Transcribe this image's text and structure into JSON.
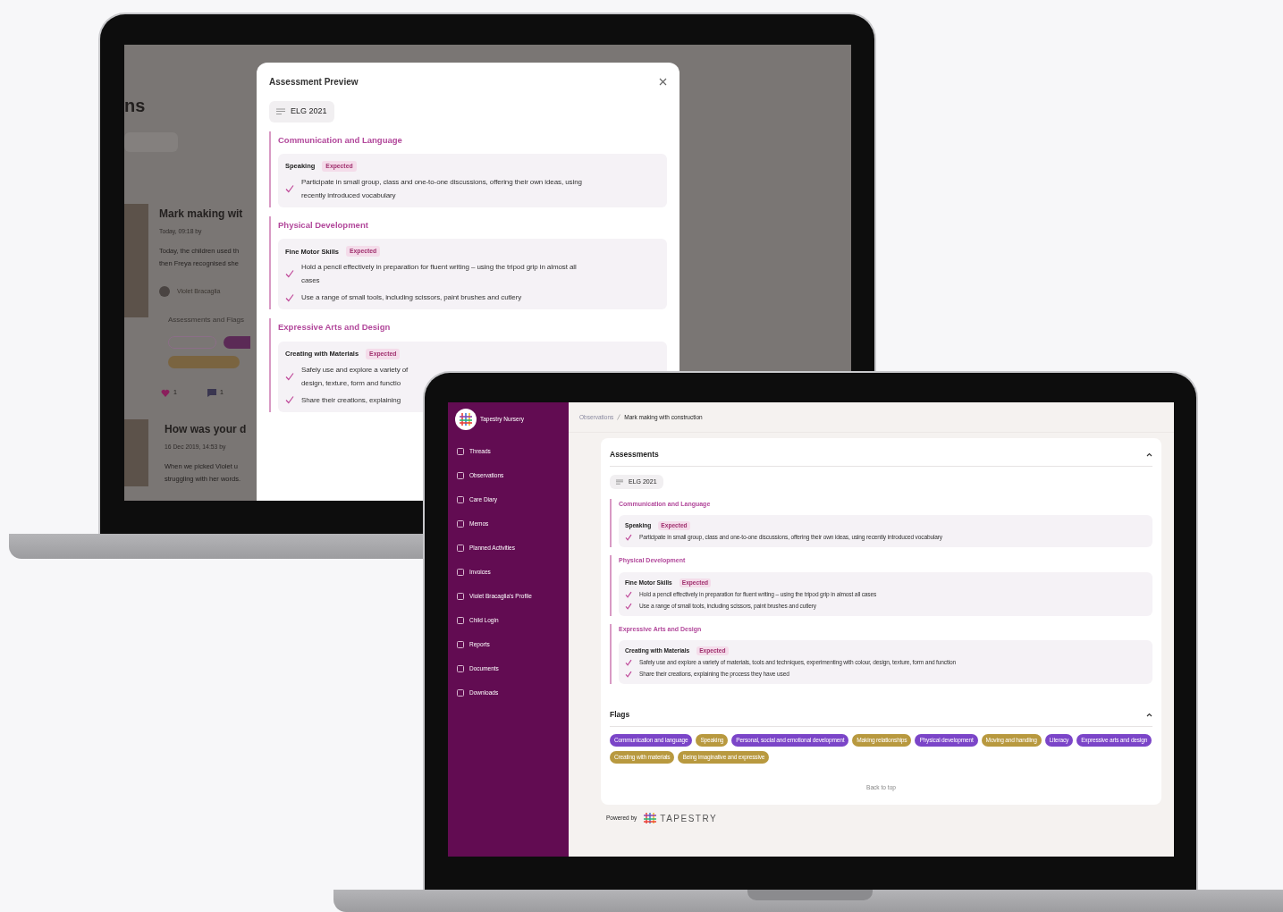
{
  "left_laptop": {
    "background_page": {
      "title_fragment": "ns",
      "posts": [
        {
          "title": "Mark making wit",
          "meta": "Today, 09:18 by",
          "lines": [
            "Today, the children used th",
            "then Freya recognised she"
          ],
          "child": "Violet Bracaglia",
          "assessments_label": "Assessments and Flags",
          "likes": "1",
          "comments": "1"
        },
        {
          "title": "How was your d",
          "meta": "16 Dec 2019, 14:53 by",
          "lines": [
            "When we picked Violet u",
            "struggling with her words."
          ]
        }
      ]
    },
    "modal": {
      "title": "Assessment Preview",
      "framework": "ELG 2021",
      "areas": [
        {
          "name": "Communication and Language",
          "skills": [
            {
              "name": "Speaking",
              "badge": "Expected",
              "statements": [
                {
                  "lines": [
                    "Participate in small group, class and one-to-one discussions, offering their own ideas, using",
                    "recently introduced vocabulary"
                  ]
                }
              ]
            }
          ]
        },
        {
          "name": "Physical Development",
          "skills": [
            {
              "name": "Fine Motor Skills",
              "badge": "Expected",
              "statements": [
                {
                  "lines": [
                    "Hold a pencil effectively in preparation for fluent writing – using the tripod grip in almost all",
                    "cases"
                  ]
                },
                {
                  "lines": [
                    "Use a range of small tools, including scissors, paint brushes and cutlery"
                  ]
                }
              ]
            }
          ]
        },
        {
          "name": "Expressive Arts and Design",
          "skills": [
            {
              "name": "Creating with Materials",
              "badge": "Expected",
              "statements": [
                {
                  "lines": [
                    "Safely use and explore a variety of",
                    "design, texture, form and functio"
                  ]
                },
                {
                  "lines": [
                    "Share their creations, explaining"
                  ]
                }
              ]
            }
          ]
        }
      ]
    }
  },
  "right_laptop": {
    "sidebar": {
      "brand": "Tapestry Nursery",
      "items": [
        {
          "label": "Threads"
        },
        {
          "label": "Observations"
        },
        {
          "label": "Care Diary"
        },
        {
          "label": "Memos"
        },
        {
          "label": "Planned Activities"
        },
        {
          "label": "Invoices"
        },
        {
          "label": "Violet Bracaglia's Profile"
        },
        {
          "label": "Child Login"
        },
        {
          "label": "Reports"
        },
        {
          "label": "Documents"
        },
        {
          "label": "Downloads"
        }
      ]
    },
    "breadcrumb": [
      "Observations",
      "Mark making with construction"
    ],
    "assessments": {
      "title": "Assessments",
      "expanded": true,
      "framework": "ELG 2021",
      "areas": [
        {
          "name": "Communication and Language",
          "skills": [
            {
              "name": "Speaking",
              "badge": "Expected",
              "statements": [
                "Participate in small group, class and one-to-one discussions, offering their own ideas, using recently introduced vocabulary"
              ]
            }
          ]
        },
        {
          "name": "Physical Development",
          "skills": [
            {
              "name": "Fine Motor Skills",
              "badge": "Expected",
              "statements": [
                "Hold a pencil effectively in preparation for fluent writing – using the tripod grip in almost all cases",
                "Use a range of small tools, including scissors, paint brushes and cutlery"
              ]
            }
          ]
        },
        {
          "name": "Expressive Arts and Design",
          "skills": [
            {
              "name": "Creating with Materials",
              "badge": "Expected",
              "statements": [
                "Safely use and explore a variety of materials, tools and techniques, experimenting with colour, design, texture, form and function",
                "Share their creations, explaining the process they have used"
              ]
            }
          ]
        }
      ]
    },
    "flags": {
      "title": "Flags",
      "expanded": true,
      "items": [
        {
          "label": "Communication and language",
          "color": "#7b45c8"
        },
        {
          "label": "Speaking",
          "color": "#b8993f"
        },
        {
          "label": "Personal, social and emotional development",
          "color": "#7b45c8"
        },
        {
          "label": "Making relationships",
          "color": "#b8993f"
        },
        {
          "label": "Physical development",
          "color": "#7b45c8"
        },
        {
          "label": "Moving and handling",
          "color": "#b8993f"
        },
        {
          "label": "Literacy",
          "color": "#7b45c8"
        },
        {
          "label": "Expressive arts and design",
          "color": "#7b45c8"
        },
        {
          "label": "Creating with materials",
          "color": "#b8993f"
        },
        {
          "label": "Being imaginative and expressive",
          "color": "#b8993f"
        }
      ]
    },
    "back_to_top": "Back to top",
    "footer": {
      "powered_by": "Powered by",
      "logo": "TAPESTRY"
    }
  }
}
